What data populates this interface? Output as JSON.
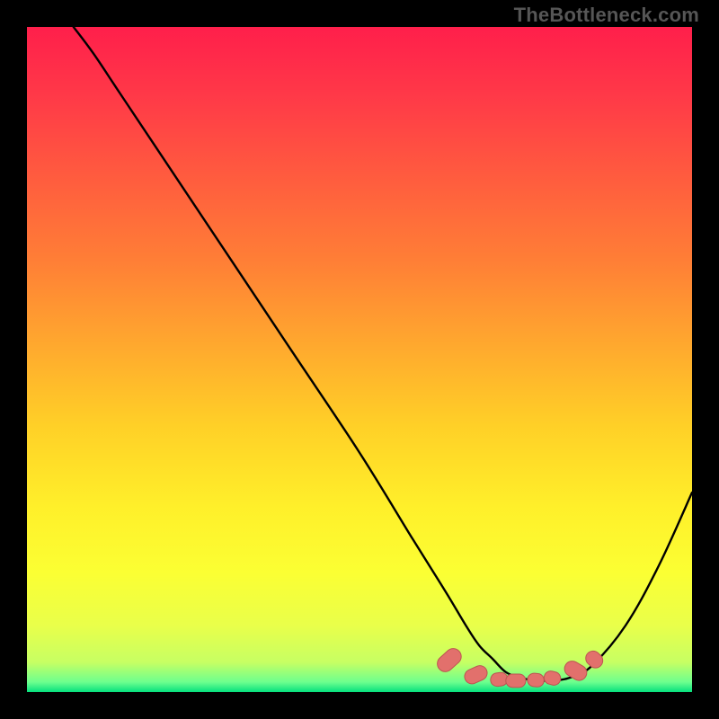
{
  "watermark": "TheBottleneck.com",
  "colors": {
    "bg": "#000000",
    "curve": "#000000",
    "marker_fill": "#e2706c",
    "marker_stroke": "#bc5551",
    "gradient_stops": [
      {
        "offset": 0.0,
        "color": "#ff1f4b"
      },
      {
        "offset": 0.1,
        "color": "#ff3848"
      },
      {
        "offset": 0.22,
        "color": "#ff5a3f"
      },
      {
        "offset": 0.35,
        "color": "#ff7e36"
      },
      {
        "offset": 0.48,
        "color": "#ffa92e"
      },
      {
        "offset": 0.6,
        "color": "#ffd027"
      },
      {
        "offset": 0.72,
        "color": "#ffef2a"
      },
      {
        "offset": 0.82,
        "color": "#fbff33"
      },
      {
        "offset": 0.9,
        "color": "#e9ff4a"
      },
      {
        "offset": 0.955,
        "color": "#c7ff63"
      },
      {
        "offset": 0.985,
        "color": "#6dff8e"
      },
      {
        "offset": 1.0,
        "color": "#05e07e"
      }
    ]
  },
  "chart_data": {
    "type": "line",
    "title": "",
    "xlabel": "",
    "ylabel": "",
    "xlim": [
      0,
      100
    ],
    "ylim": [
      0,
      100
    ],
    "grid": false,
    "series": [
      {
        "name": "bottleneck-curve",
        "x": [
          7,
          10,
          14,
          20,
          30,
          40,
          50,
          58,
          63,
          66,
          68,
          70,
          72,
          74,
          76,
          78,
          80,
          82,
          85,
          90,
          95,
          100
        ],
        "values": [
          100,
          96,
          90,
          81,
          66,
          51,
          36,
          23,
          15,
          10,
          7,
          5,
          3,
          2.2,
          1.8,
          1.7,
          1.8,
          2.3,
          4,
          10,
          19,
          30
        ]
      }
    ],
    "markers": {
      "name": "optimal-range",
      "shape": "rounded-capsule",
      "points": [
        {
          "x": 63.5,
          "y": 4.8,
          "w": 4.0,
          "h": 2.4,
          "rot": -42
        },
        {
          "x": 67.5,
          "y": 2.6,
          "w": 3.5,
          "h": 2.2,
          "rot": -24
        },
        {
          "x": 71.0,
          "y": 1.9,
          "w": 2.6,
          "h": 2.0,
          "rot": -8
        },
        {
          "x": 73.5,
          "y": 1.7,
          "w": 3.0,
          "h": 2.0,
          "rot": 0
        },
        {
          "x": 76.5,
          "y": 1.8,
          "w": 2.5,
          "h": 2.0,
          "rot": 6
        },
        {
          "x": 79.0,
          "y": 2.1,
          "w": 2.5,
          "h": 2.0,
          "rot": 14
        },
        {
          "x": 82.5,
          "y": 3.2,
          "w": 3.5,
          "h": 2.3,
          "rot": 30
        },
        {
          "x": 85.3,
          "y": 4.9,
          "w": 2.7,
          "h": 2.2,
          "rot": 44
        }
      ]
    }
  }
}
